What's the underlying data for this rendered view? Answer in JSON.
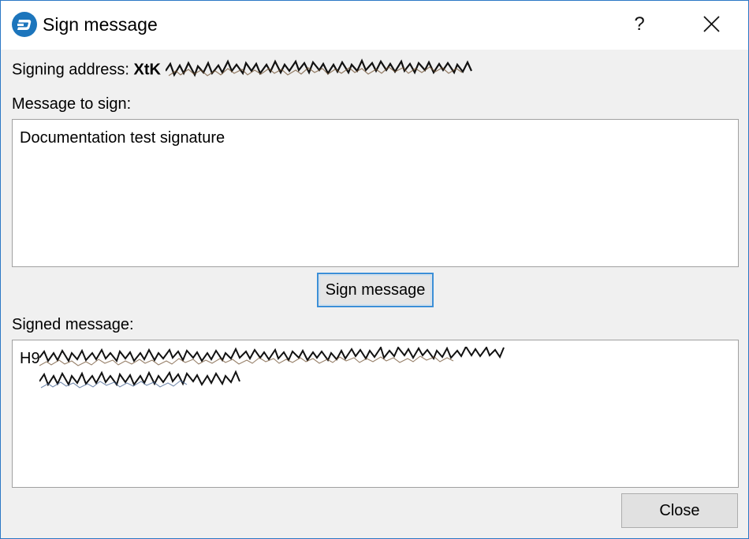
{
  "window": {
    "title": "Sign message",
    "help_label": "?"
  },
  "form": {
    "address_label": "Signing address:",
    "address_value_visible": "XtK",
    "message_label": "Message to sign:",
    "message_value": "Documentation test signature",
    "sign_button": "Sign message",
    "signed_label": "Signed message:",
    "signed_value_visible": "H9",
    "close_button": "Close"
  },
  "colors": {
    "accent": "#2b78c5",
    "app_icon": "#1c75bc"
  },
  "icons": {
    "app": "dash-logo-icon",
    "help": "help-icon",
    "close": "close-icon"
  }
}
